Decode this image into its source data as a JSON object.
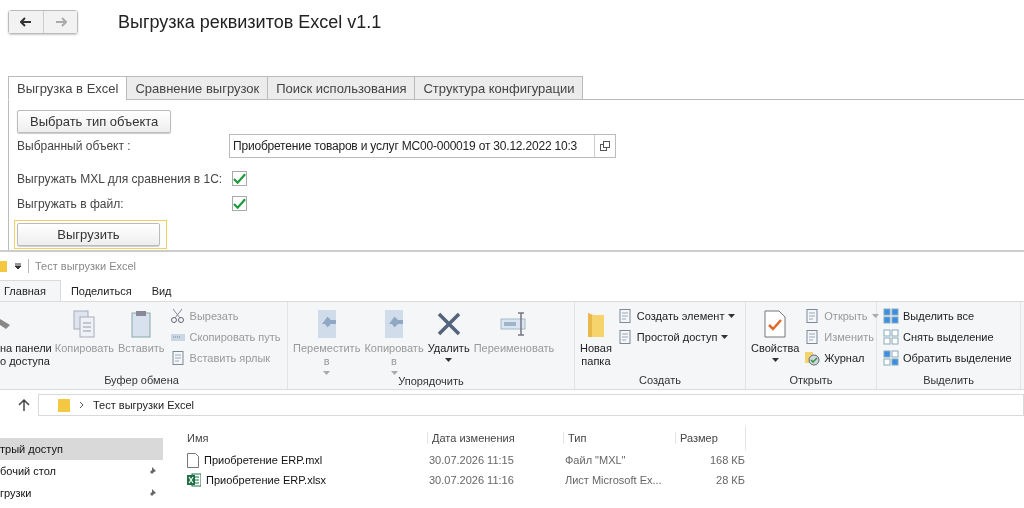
{
  "form": {
    "title": "Выгрузка реквизитов Excel v1.1",
    "tabs": [
      {
        "label": "Выгрузка в Excel",
        "selected": true
      },
      {
        "label": "Сравнение выгрузок",
        "selected": false
      },
      {
        "label": "Поиск использования",
        "selected": false
      },
      {
        "label": "Структура конфигурации",
        "selected": false
      }
    ],
    "select_type_button": "Выбрать тип объекта",
    "fields": [
      {
        "kind": "input",
        "label": "Выбранный объект :",
        "value": "Приобретение товаров и услуг МС00-000019 от 30.12.2022 10:3"
      },
      {
        "kind": "checkbox",
        "label": "Выгружать MXL для сравнения в 1С:",
        "checked": true
      },
      {
        "kind": "checkbox",
        "label": "Выгружать в файл:",
        "checked": true
      }
    ],
    "export_button": "Выгрузить"
  },
  "explorer": {
    "title": "Тест выгрузки Excel",
    "ribbon_tabs": [
      {
        "label": "Главная",
        "selected": true
      },
      {
        "label": "Поделиться",
        "selected": false
      },
      {
        "label": "Вид",
        "selected": false
      }
    ],
    "ribbon_groups": [
      {
        "title": "Буфер обмена",
        "items": [
          {
            "kind": "large",
            "lines": [
              "на панели",
              "о доступа"
            ],
            "disabled": false,
            "dropdown": false
          },
          {
            "kind": "large",
            "lines": [
              "Копировать"
            ],
            "disabled": true,
            "dropdown": false
          },
          {
            "kind": "large",
            "lines": [
              "Вставить"
            ],
            "disabled": true,
            "dropdown": false
          },
          {
            "kind": "small",
            "lines": [
              "Вырезать"
            ],
            "disabled": true,
            "dropdown": false
          },
          {
            "kind": "small",
            "lines": [
              "Скопировать путь"
            ],
            "disabled": true,
            "dropdown": false
          },
          {
            "kind": "small",
            "lines": [
              "Вставить ярлык"
            ],
            "disabled": true,
            "dropdown": false
          }
        ]
      },
      {
        "title": "Упорядочить",
        "items": [
          {
            "kind": "large",
            "lines": [
              "Переместить",
              "в"
            ],
            "disabled": true,
            "dropdown": true
          },
          {
            "kind": "large",
            "lines": [
              "Копировать",
              "в"
            ],
            "disabled": true,
            "dropdown": true
          },
          {
            "kind": "large",
            "lines": [
              "Удалить"
            ],
            "disabled": false,
            "dropdown": true
          },
          {
            "kind": "large",
            "lines": [
              "Переименовать"
            ],
            "disabled": true,
            "dropdown": false
          }
        ]
      },
      {
        "title": "Создать",
        "items": [
          {
            "kind": "large",
            "lines": [
              "Новая",
              "папка"
            ],
            "disabled": false,
            "dropdown": false
          },
          {
            "kind": "small",
            "lines": [
              "Создать элемент"
            ],
            "disabled": false,
            "dropdown": true
          },
          {
            "kind": "small",
            "lines": [
              "Простой доступ"
            ],
            "disabled": false,
            "dropdown": true
          }
        ]
      },
      {
        "title": "Открыть",
        "items": [
          {
            "kind": "large",
            "lines": [
              "Свойства"
            ],
            "disabled": false,
            "dropdown": true
          },
          {
            "kind": "small",
            "lines": [
              "Открыть"
            ],
            "disabled": true,
            "dropdown": true
          },
          {
            "kind": "small",
            "lines": [
              "Изменить"
            ],
            "disabled": true,
            "dropdown": false
          },
          {
            "kind": "small",
            "lines": [
              "Журнал"
            ],
            "disabled": false,
            "dropdown": false
          }
        ]
      },
      {
        "title": "Выделить",
        "items": [
          {
            "kind": "small",
            "lines": [
              "Выделить все"
            ],
            "disabled": false,
            "dropdown": false
          },
          {
            "kind": "small",
            "lines": [
              "Снять выделение"
            ],
            "disabled": false,
            "dropdown": false
          },
          {
            "kind": "small",
            "lines": [
              "Обратить выделение"
            ],
            "disabled": false,
            "dropdown": false
          }
        ]
      }
    ],
    "address": "Тест выгрузки Excel",
    "nav_items": [
      {
        "label": "трый доступ",
        "selected": true,
        "pinned": false
      },
      {
        "label": "бочий стол",
        "selected": false,
        "pinned": true
      },
      {
        "label": "грузки",
        "selected": false,
        "pinned": true
      }
    ],
    "columns": [
      "Имя",
      "Дата изменения",
      "Тип",
      "Размер"
    ],
    "files": [
      {
        "kind": "mxl",
        "name": "Приобретение ERP.mxl",
        "date": "30.07.2026 11:15",
        "type": "Файл \"MXL\"",
        "size": "168 КБ"
      },
      {
        "kind": "xlsx",
        "name": "Приобретение ERP.xlsx",
        "date": "30.07.2026 11:16",
        "type": "Лист Microsoft Ex...",
        "size": "28 КБ"
      }
    ]
  }
}
